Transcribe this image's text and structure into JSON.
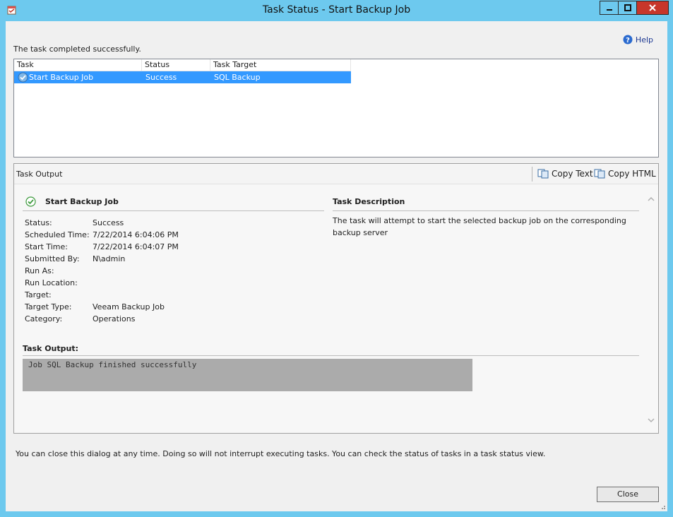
{
  "window": {
    "title": "Task Status - Start Backup Job",
    "buttons": [
      "minimize",
      "maximize",
      "close"
    ]
  },
  "help": {
    "label": "Help",
    "icon": "help-icon"
  },
  "status_message": "The task completed successfully.",
  "task_list": {
    "columns": [
      "Task",
      "Status",
      "Task Target"
    ],
    "rows": [
      {
        "task": "Start Backup Job",
        "status": "Success",
        "target": "SQL Backup",
        "selected": true,
        "icon": "check-circle-icon"
      }
    ]
  },
  "output_panel": {
    "title": "Task Output",
    "copy_text_label": "Copy Text",
    "copy_html_label": "Copy HTML",
    "task_name": "Start Backup Job",
    "properties": [
      {
        "label": "Status:",
        "value": "Success"
      },
      {
        "label": "Scheduled Time:",
        "value": "7/22/2014 6:04:06 PM"
      },
      {
        "label": "Start Time:",
        "value": "7/22/2014 6:04:07 PM"
      },
      {
        "label": "Submitted By:",
        "value": "N\\admin"
      },
      {
        "label": "Run As:",
        "value": ""
      },
      {
        "label": "Run Location:",
        "value": ""
      },
      {
        "label": "Target:",
        "value": ""
      },
      {
        "label": "Target Type:",
        "value": "Veeam Backup Job"
      },
      {
        "label": "Category:",
        "value": "Operations"
      }
    ],
    "description_heading": "Task Description",
    "description": "The task will attempt to start the selected backup job on the corresponding backup server",
    "output_heading": "Task Output:",
    "output_text": "Job SQL Backup finished successfully"
  },
  "footer_note": "You can close this dialog at any time. Doing so will not interrupt executing tasks. You can check the status of tasks in a task status view.",
  "close_label": "Close",
  "colors": {
    "title_bar": "#6dc9ee",
    "close_button": "#c7362a",
    "selection": "#3399ff",
    "output_box": "#ababab"
  }
}
